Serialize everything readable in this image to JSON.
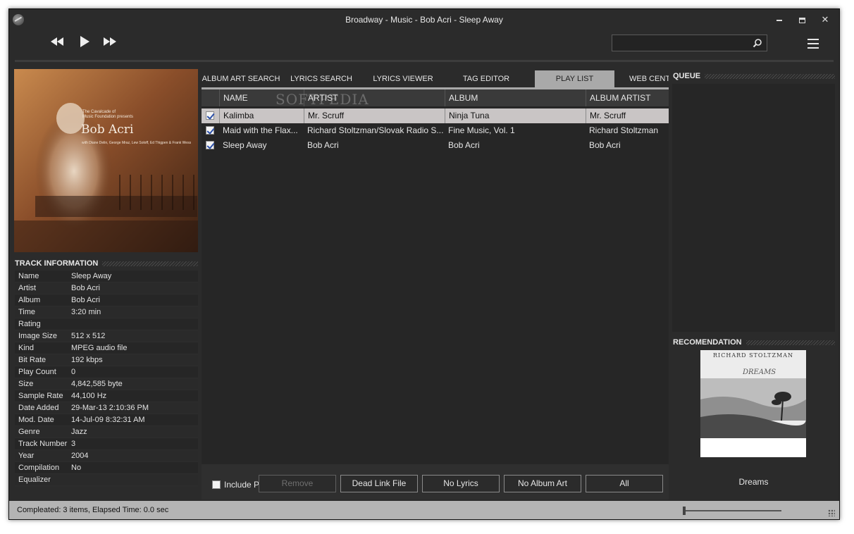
{
  "window": {
    "title": "Broadway - Music - Bob Acri - Sleep Away"
  },
  "toolbar": {
    "search_placeholder": "",
    "icons": [
      "rewind-icon",
      "play-icon",
      "fast-forward-icon",
      "search-icon",
      "hamburger-menu-icon"
    ]
  },
  "track_info": {
    "header": "TRACK INFORMATION",
    "rows": [
      {
        "k": "Name",
        "v": "Sleep Away"
      },
      {
        "k": "Artist",
        "v": "Bob Acri"
      },
      {
        "k": "Album",
        "v": "Bob Acri"
      },
      {
        "k": "Time",
        "v": "3:20 min"
      },
      {
        "k": "Rating",
        "v": ""
      },
      {
        "k": "Image Size",
        "v": "512 x 512"
      },
      {
        "k": "Kind",
        "v": "MPEG audio file"
      },
      {
        "k": "Bit Rate",
        "v": "192 kbps"
      },
      {
        "k": "Play Count",
        "v": "0"
      },
      {
        "k": "Size",
        "v": "4,842,585 byte"
      },
      {
        "k": "Sample Rate",
        "v": "44,100 Hz"
      },
      {
        "k": "Date Added",
        "v": "29-Mar-13 2:10:36 PM"
      },
      {
        "k": "Mod. Date",
        "v": "14-Jul-09 8:32:31 AM"
      },
      {
        "k": "Genre",
        "v": "Jazz"
      },
      {
        "k": "Track Number",
        "v": "3"
      },
      {
        "k": "Year",
        "v": "2004"
      },
      {
        "k": "Compilation",
        "v": "No"
      },
      {
        "k": "Equalizer",
        "v": ""
      }
    ]
  },
  "album_art": {
    "artist": "Bob Acri",
    "line1": "The Cavalcade of",
    "line2": "Music Foundation presents",
    "credits": "with Diane Delin, George Mraz, Lew Soloff, Ed Thigpen & Frank Wess"
  },
  "tabs": [
    {
      "label": "ALBUM ART SEARCH",
      "active": false
    },
    {
      "label": "LYRICS SEARCH",
      "active": false
    },
    {
      "label": "LYRICS VIEWER",
      "active": false
    },
    {
      "label": "TAG EDITOR",
      "active": false
    },
    {
      "label": "PLAY LIST",
      "active": true
    },
    {
      "label": "WEB CENTRAL",
      "active": false
    }
  ],
  "playlist": {
    "columns": [
      "NAME",
      "ARTIST",
      "ALBUM",
      "ALBUM ARTIST"
    ],
    "watermark": "SOFTPEDIA",
    "rows": [
      {
        "name": "Kalimba",
        "artist": "Mr. Scruff",
        "album": "Ninja Tuna",
        "album_artist": "Mr. Scruff",
        "checked": true,
        "selected": true
      },
      {
        "name": "Maid with the Flax...",
        "artist": "Richard Stoltzman/Slovak Radio S...",
        "album": "Fine Music, Vol. 1",
        "album_artist": "Richard Stoltzman",
        "checked": true,
        "selected": false
      },
      {
        "name": "Sleep Away",
        "artist": "Bob Acri",
        "album": "Bob Acri",
        "album_artist": "Bob Acri",
        "checked": true,
        "selected": false
      }
    ]
  },
  "playlist_footer": {
    "include_label": "Include P",
    "buttons": {
      "remove": "Remove",
      "dead_link": "Dead Link File",
      "no_lyrics": "No Lyrics",
      "no_album_art": "No Album Art",
      "all": "All"
    }
  },
  "queue": {
    "header": "QUEUE"
  },
  "recommendation": {
    "header": "RECOMENDATION",
    "cover_artist": "RICHARD STOLTZMAN",
    "cover_title": "DREAMS",
    "caption": "Dreams"
  },
  "status": {
    "text": "Compleated: 3 items,  Elapsed Time: 0.0 sec",
    "volume": 0.0
  },
  "colors": {
    "background": "#2b2b2b",
    "panel": "#262626",
    "active_tab": "#a9a9a9",
    "selected_row": "#c9c5c5",
    "statusbar": "#b4b4b4"
  }
}
